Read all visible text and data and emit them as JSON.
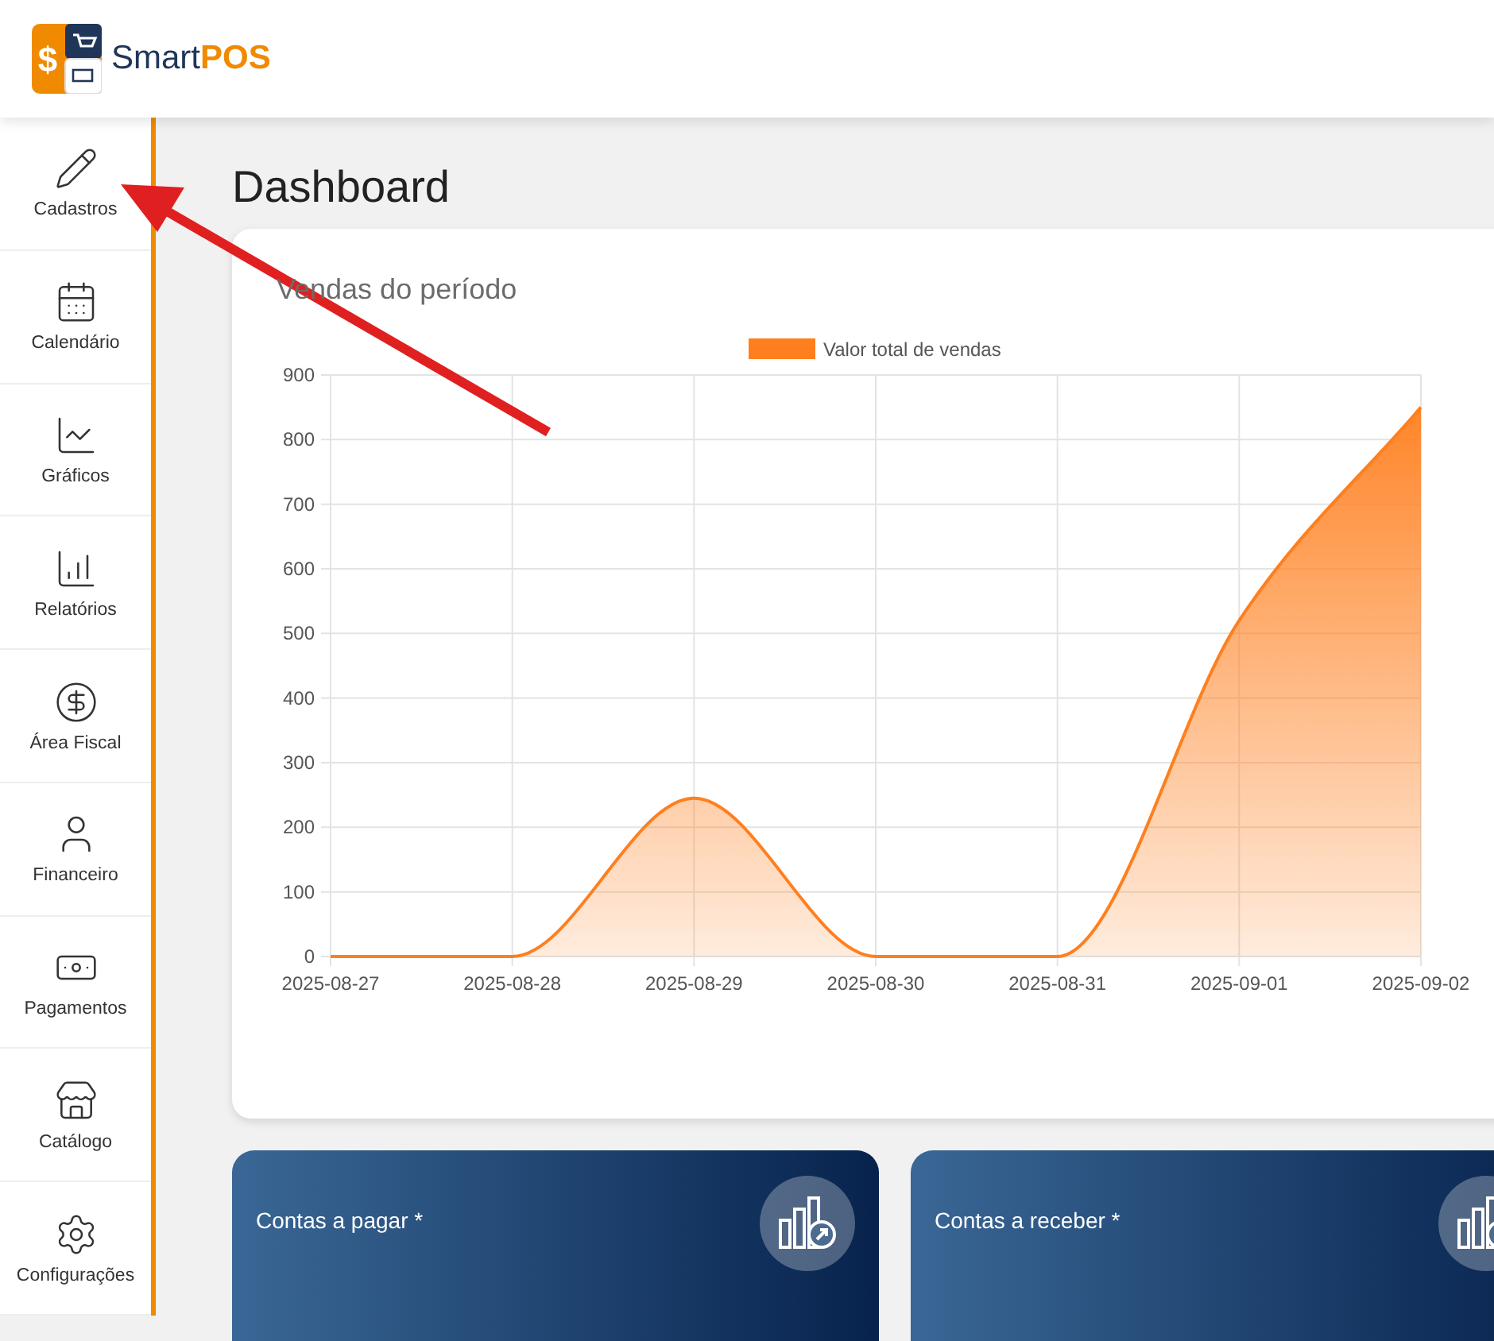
{
  "brand": {
    "mark": "$",
    "name": "Smart",
    "accent": "POS"
  },
  "sidebar": {
    "items": [
      {
        "label": "Cadastros",
        "kind": "pencil"
      },
      {
        "label": "Calendário",
        "kind": "calendar"
      },
      {
        "label": "Gráficos",
        "kind": "linechart"
      },
      {
        "label": "Relatórios",
        "kind": "barchart"
      },
      {
        "label": "Área Fiscal",
        "kind": "dollar"
      },
      {
        "label": "Financeiro",
        "kind": "user"
      },
      {
        "label": "Pagamentos",
        "kind": "banknote"
      },
      {
        "label": "Catálogo",
        "kind": "store"
      },
      {
        "label": "Configurações",
        "kind": "settings"
      }
    ]
  },
  "page_title": "Dashboard",
  "sales_card": {
    "title": "Vendas do período",
    "chart_data": {
      "type": "area",
      "categories": [
        "2025-08-27",
        "2025-08-28",
        "2025-08-29",
        "2025-08-30",
        "2025-08-31",
        "2025-09-01",
        "2025-09-02"
      ],
      "series": [
        {
          "name": "Valor total de vendas",
          "color": "#ff7f1e",
          "values": [
            0,
            0,
            245,
            0,
            0,
            520,
            850
          ]
        }
      ],
      "ylim": [
        0,
        900
      ],
      "grid": true,
      "yticks": [
        0,
        100,
        200,
        300,
        400,
        500,
        600,
        700,
        800,
        900
      ]
    }
  },
  "summary_cards": [
    {
      "title": "Contas a pagar *"
    },
    {
      "title": "Contas a receber *"
    }
  ]
}
